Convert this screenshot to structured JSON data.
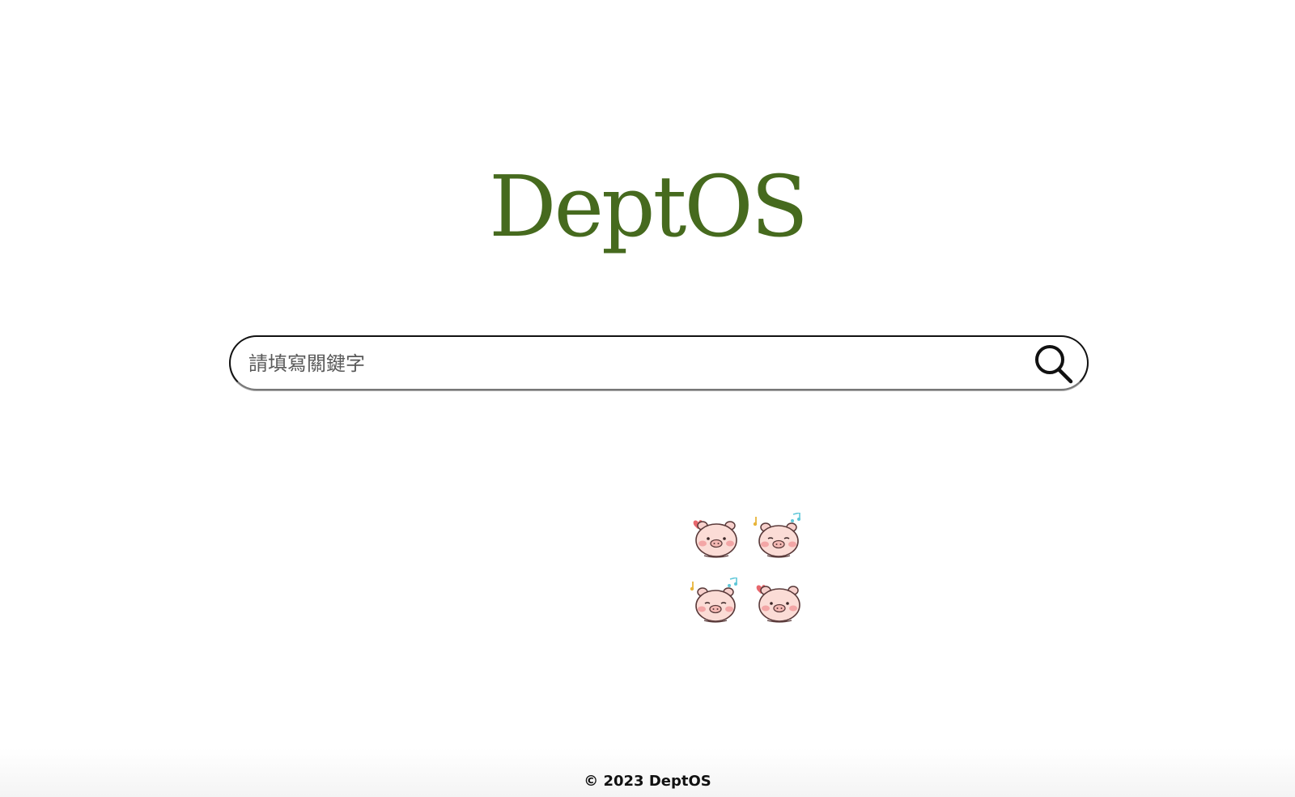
{
  "header": {
    "logo_text": "DeptOS",
    "logo_color": "#466a1e"
  },
  "search": {
    "placeholder": "請填寫關鍵字",
    "value": "",
    "button_icon": "search-icon"
  },
  "stickers": [
    {
      "name": "pig-heart-sticker"
    },
    {
      "name": "pig-music-sticker"
    },
    {
      "name": "pig-music-sticker"
    },
    {
      "name": "pig-heart-sticker"
    }
  ],
  "footer": {
    "copyright": "© 2023 DeptOS"
  }
}
